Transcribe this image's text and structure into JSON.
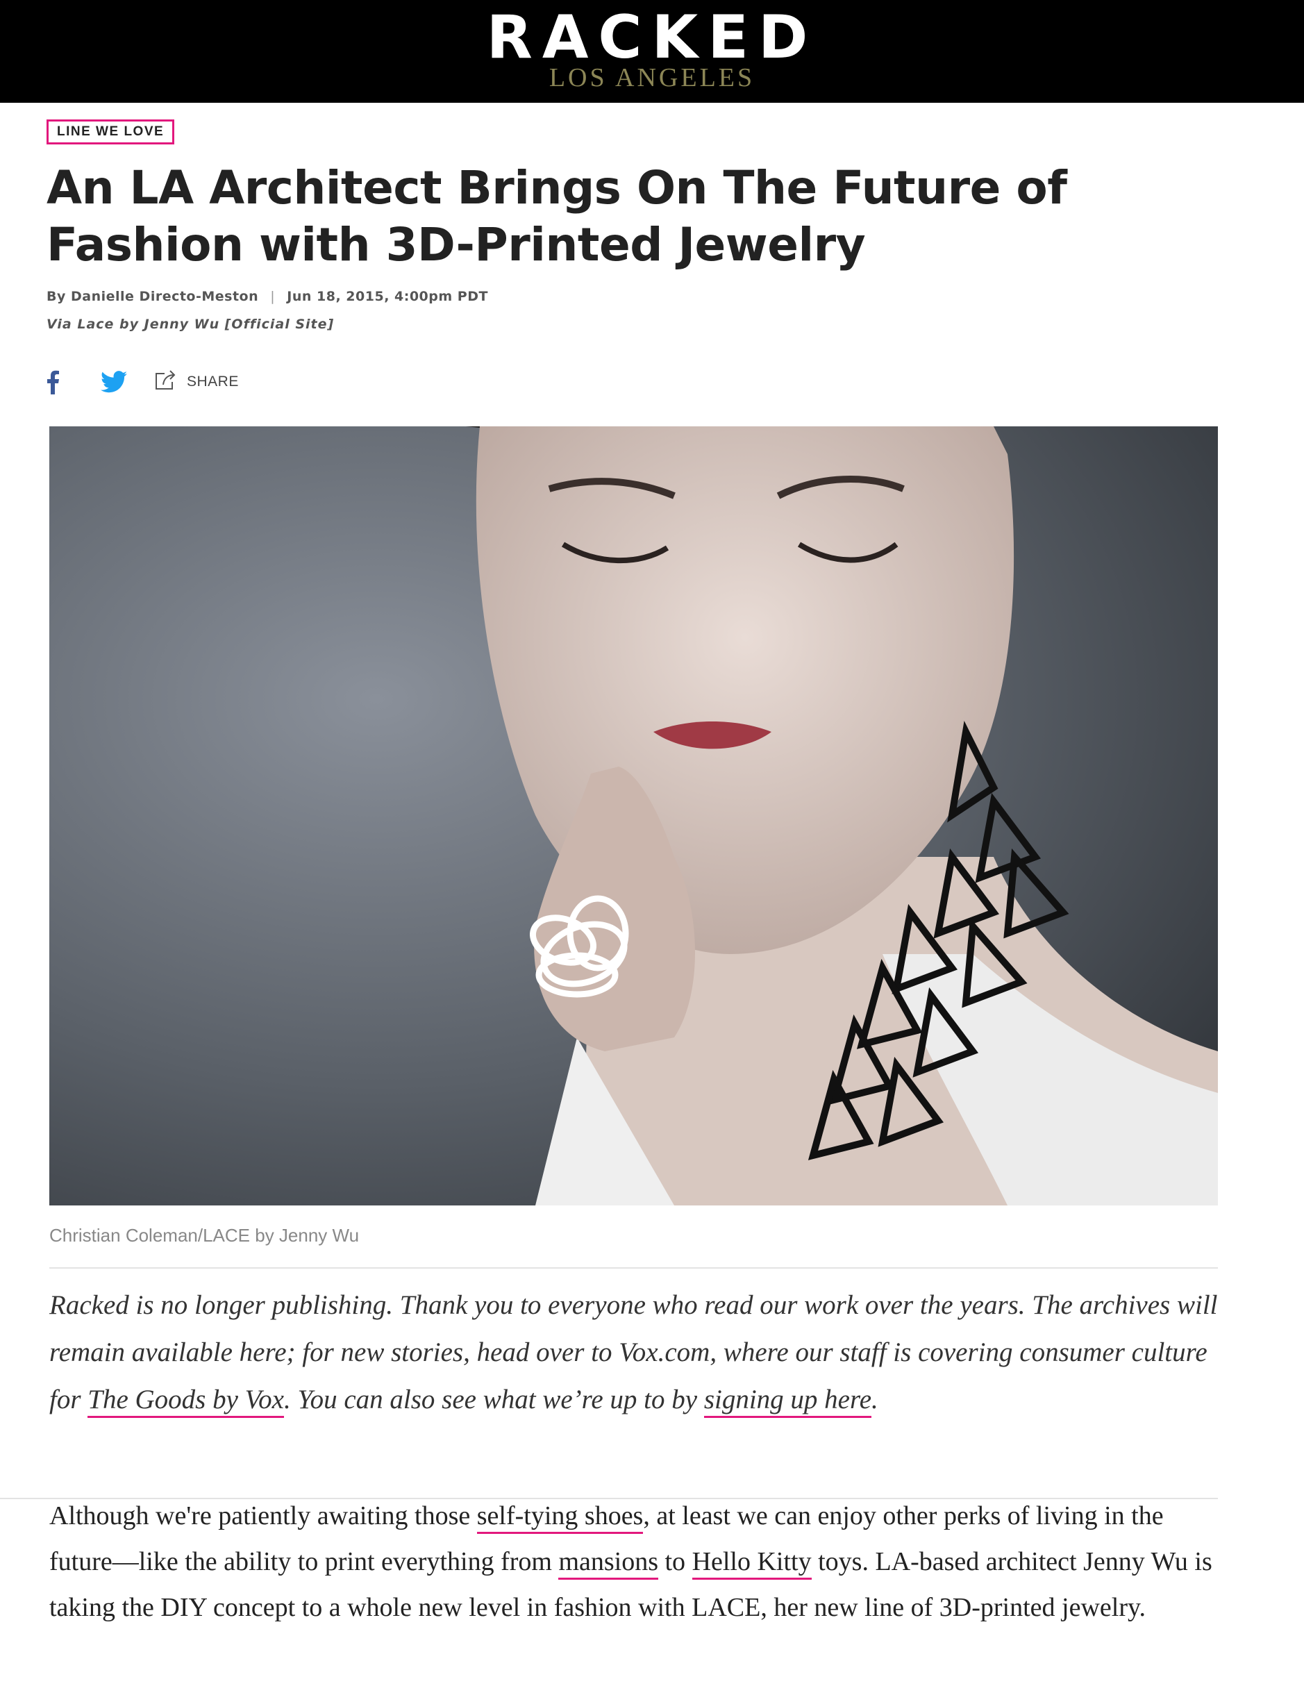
{
  "header": {
    "logo_main": "RACKED",
    "logo_sub": "LOS ANGELES"
  },
  "article": {
    "tag": "LINE WE LOVE",
    "title": "An LA Architect Brings On The Future of Fashion with 3D-Printed Jewelry",
    "byline_prefix": "By",
    "author": "Danielle Directo-Meston",
    "byline_sep": "|",
    "date": "Jun 18, 2015, 4:00pm PDT",
    "via_prefix": "Via",
    "via_link": "Lace by Jenny Wu [Official Site]",
    "share_label": "SHARE",
    "image_caption": "Christian Coleman/LACE by Jenny Wu"
  },
  "notice": {
    "text_1": "Racked is no longer publishing. Thank you to everyone who read our work over the years. The archives will remain available here; for new stories, head over to Vox.com, where our staff is covering consumer culture for ",
    "link_1": "The Goods by Vox",
    "text_2": ". You can also see what we’re up to by ",
    "link_2": "signing up here",
    "text_3": "."
  },
  "body": {
    "text_1": "Although we're patiently awaiting those ",
    "link_1": "self-tying shoes",
    "text_2": ", at least we can enjoy other perks of living in the future—like the ability to print everything from ",
    "link_2": "mansions",
    "text_3": " to ",
    "link_3": "Hello Kitty",
    "text_4": " toys. LA-based architect Jenny Wu is taking the DIY concept to a whole new level in fashion with LACE, her new line of 3D-printed jewelry."
  },
  "colors": {
    "accent": "#e2187d",
    "masthead_bg": "#000000",
    "logo_sub": "#8c8656",
    "facebook": "#3b5998",
    "twitter": "#1da1f2"
  },
  "icons": {
    "facebook": "facebook-icon",
    "twitter": "twitter-icon",
    "share": "share-icon"
  }
}
